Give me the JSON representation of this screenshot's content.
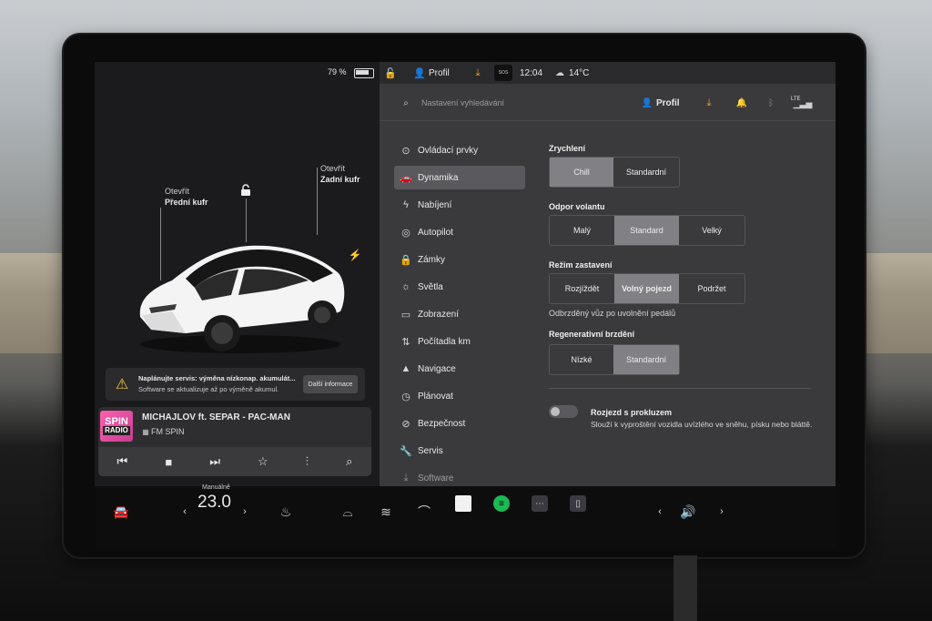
{
  "status": {
    "battery": "79 %",
    "profile": "Profil",
    "sos": "SOS",
    "time": "12:04",
    "temp": "14°C"
  },
  "car_view": {
    "front_trunk_action": "Otevřít",
    "front_trunk_label": "Přední kufr",
    "rear_trunk_action": "Otevřít",
    "rear_trunk_label": "Zadní kufr"
  },
  "notification": {
    "title": "Naplánujte servis: výměna nízkonap. akumulát...",
    "body": "Software se aktualizuje až po výměně akumul.",
    "button": "Další informace"
  },
  "media": {
    "logo_top": "SPIN",
    "logo_bottom": "RADIO",
    "track": "MICHAJLOV ft. SEPAR - PAC-MAN",
    "station": "FM SPIN"
  },
  "settings": {
    "search_placeholder": "Nastavení vyhledávání",
    "profile": "Profil",
    "lte": "LTE",
    "nav": [
      {
        "label": "Ovládací prvky",
        "icon": "toggle-icon"
      },
      {
        "label": "Dynamika",
        "icon": "car-icon"
      },
      {
        "label": "Nabíjení",
        "icon": "bolt-icon"
      },
      {
        "label": "Autopilot",
        "icon": "steering-wheel-icon"
      },
      {
        "label": "Zámky",
        "icon": "lock-icon"
      },
      {
        "label": "Světla",
        "icon": "sun-icon"
      },
      {
        "label": "Zobrazení",
        "icon": "display-icon"
      },
      {
        "label": "Počítadla km",
        "icon": "odometer-icon"
      },
      {
        "label": "Navigace",
        "icon": "navigation-icon"
      },
      {
        "label": "Plánovat",
        "icon": "clock-icon"
      },
      {
        "label": "Bezpečnost",
        "icon": "shield-icon"
      },
      {
        "label": "Servis",
        "icon": "wrench-icon"
      },
      {
        "label": "Software",
        "icon": "download-icon"
      }
    ],
    "acceleration": {
      "title": "Zrychlení",
      "options": [
        "Chill",
        "Standardní"
      ],
      "selected": "Chill"
    },
    "steering": {
      "title": "Odpor volantu",
      "options": [
        "Malý",
        "Standard",
        "Velký"
      ],
      "selected": "Standard"
    },
    "stopping": {
      "title": "Režim zastavení",
      "options": [
        "Rozjíždět",
        "Volný pojezd",
        "Podržet"
      ],
      "selected": "Volný pojezd",
      "note": "Odbrzděný vůz po uvolnění pedálů"
    },
    "regen": {
      "title": "Regenerativní brzdění",
      "options": [
        "Nízké",
        "Standardní"
      ],
      "selected": "Standardní"
    },
    "slip_start": {
      "title": "Rozjezd s prokluzem",
      "description": "Slouží k vyproštění vozidla uvízlého ve sněhu, písku nebo bláttě.",
      "enabled": false
    }
  },
  "dock": {
    "climate_mode": "Manuálně",
    "temperature": "23.0"
  }
}
